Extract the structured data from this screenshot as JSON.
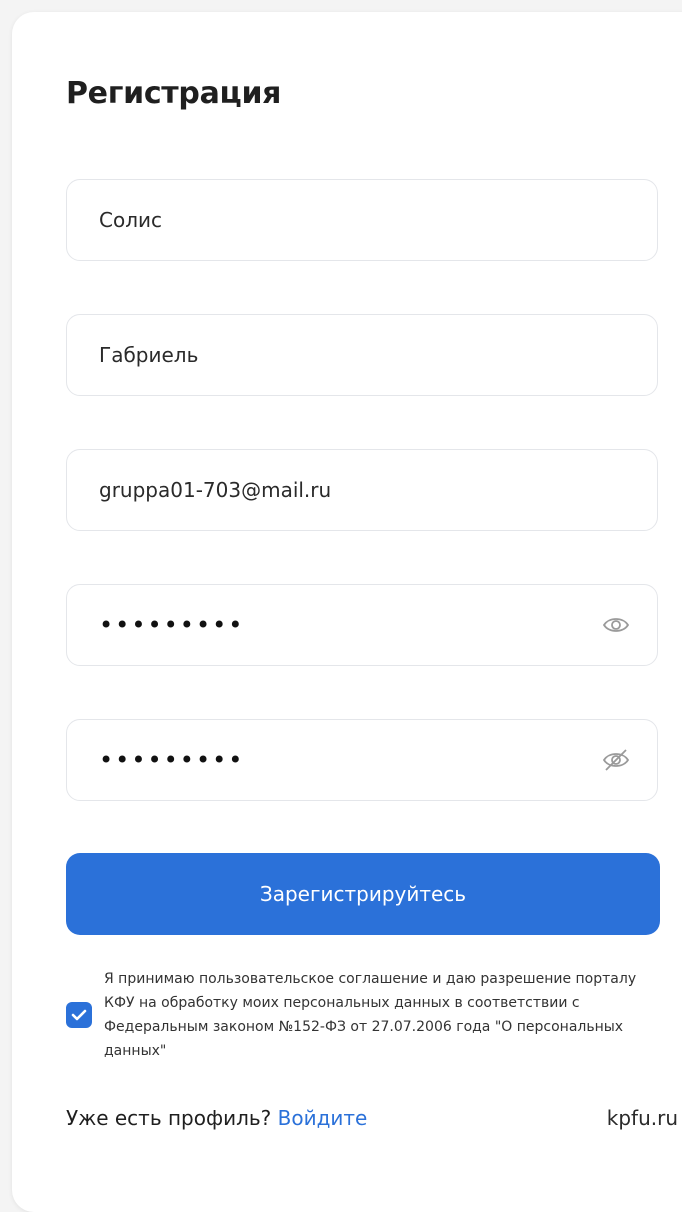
{
  "form": {
    "title": "Регистрация",
    "last_name": "Солис",
    "first_name": "Габриель",
    "email": "gruppa01-703@mail.ru",
    "password": "•••••••••",
    "password_confirm": "•••••••••",
    "submit_label": "Зарегистрируйтесь"
  },
  "agreement": {
    "checked": true,
    "text": "Я принимаю пользовательское соглашение и даю разрешение порталу КФУ на обработку моих персональных данных в соответствии с Федеральным законом №152-ФЗ от 27.07.2006 года \"О персональных данных\""
  },
  "footer": {
    "prompt": "Уже есть профиль?",
    "login_link": "Войдите",
    "site_link": "kpfu.ru"
  },
  "icons": {
    "password_toggle_visible": "eye-icon",
    "password_toggle_hidden": "eye-off-icon",
    "checkbox_check": "checkmark-icon"
  },
  "colors": {
    "accent": "#2b71d9",
    "card_background": "#ffffff",
    "page_background": "#f4f4f4",
    "field_border": "#e4e6ea"
  }
}
